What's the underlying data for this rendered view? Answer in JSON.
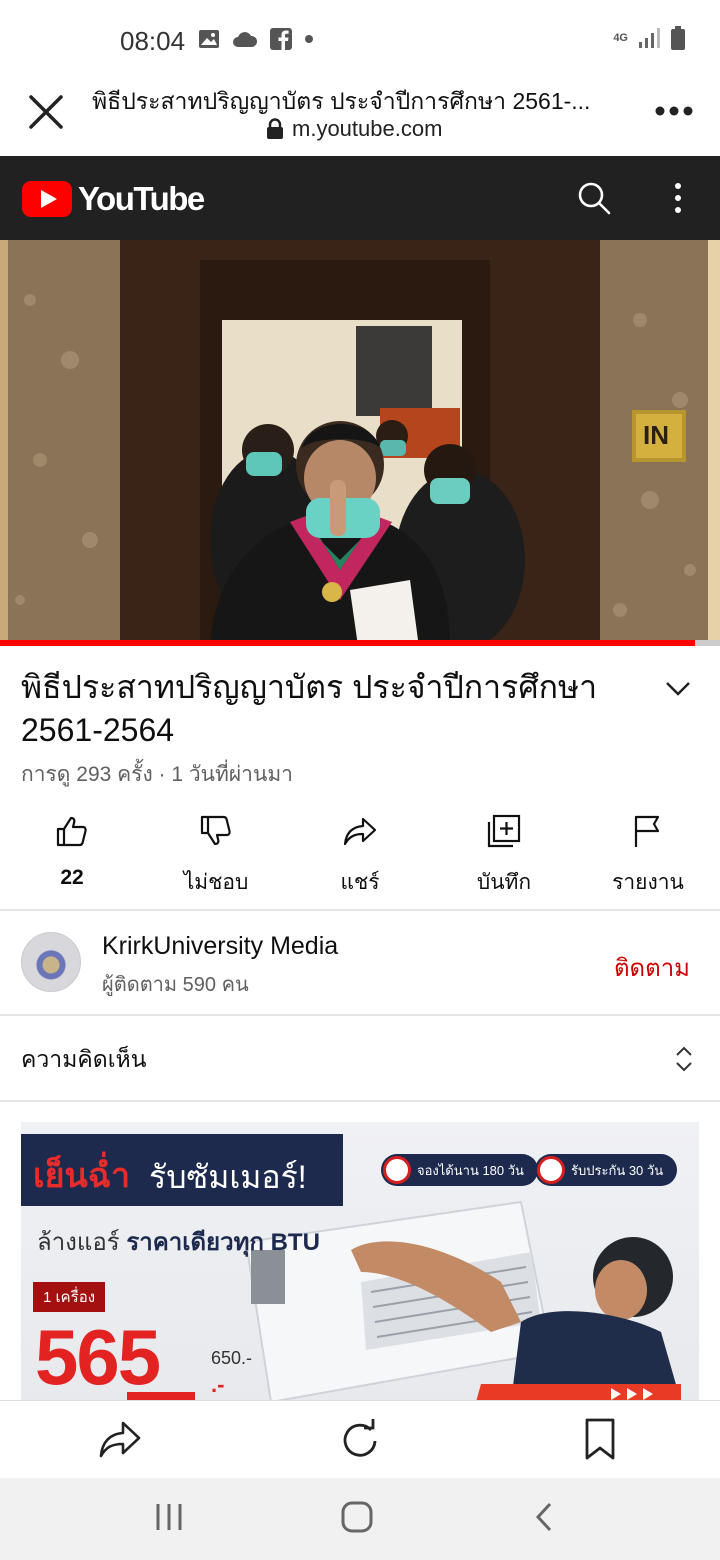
{
  "status": {
    "time": "08:04",
    "network": "4G"
  },
  "browser": {
    "title": "พิธีประสาทปริญญาบัตร ประจำปีการศึกษา 2561-...",
    "url": "m.youtube.com"
  },
  "youtube": {
    "logo_text": "YouTube",
    "accent": "#ff0000"
  },
  "video": {
    "door_sign": "IN",
    "progress_fraction": 0.965
  },
  "details": {
    "title": "พิธีประสาทปริญญาบัตร ประจำปีการศึกษา 2561-2564",
    "meta": "การดู 293 ครั้ง · 1 วันที่ผ่านมา"
  },
  "actions": [
    {
      "icon": "like-icon",
      "label": "22"
    },
    {
      "icon": "dislike-icon",
      "label": "ไม่ชอบ"
    },
    {
      "icon": "share-icon",
      "label": "แชร์"
    },
    {
      "icon": "save-icon",
      "label": "บันทึก"
    },
    {
      "icon": "report-flag-icon",
      "label": "รายงาน"
    }
  ],
  "channel": {
    "name": "KrirkUniversity Media",
    "subscribers": "ผู้ติดตาม 590 คน",
    "subscribe_label": "ติดตาม",
    "subscribe_color": "#cc0000"
  },
  "comments": {
    "label": "ความคิดเห็น"
  },
  "ad": {
    "headline_red": "เย็นฉ่ำ",
    "headline_white": "รับซัมเมอร์!",
    "badge1": "จองได้นาน 180 วัน",
    "badge2": "รับประกัน 30 วัน",
    "subline_prefix": "ล้างแอร์ ",
    "subline_bold": "ราคาเดียวทุก BTU",
    "unit_tag": "1 เครื่อง",
    "price": "565",
    "old_price": "650.-",
    "price_suffix": ".-"
  },
  "toolbar": {
    "items": [
      "share-icon",
      "reload-icon",
      "bookmark-icon"
    ]
  },
  "navbar": {
    "items": [
      "recent-apps-icon",
      "home-icon",
      "back-icon"
    ]
  }
}
